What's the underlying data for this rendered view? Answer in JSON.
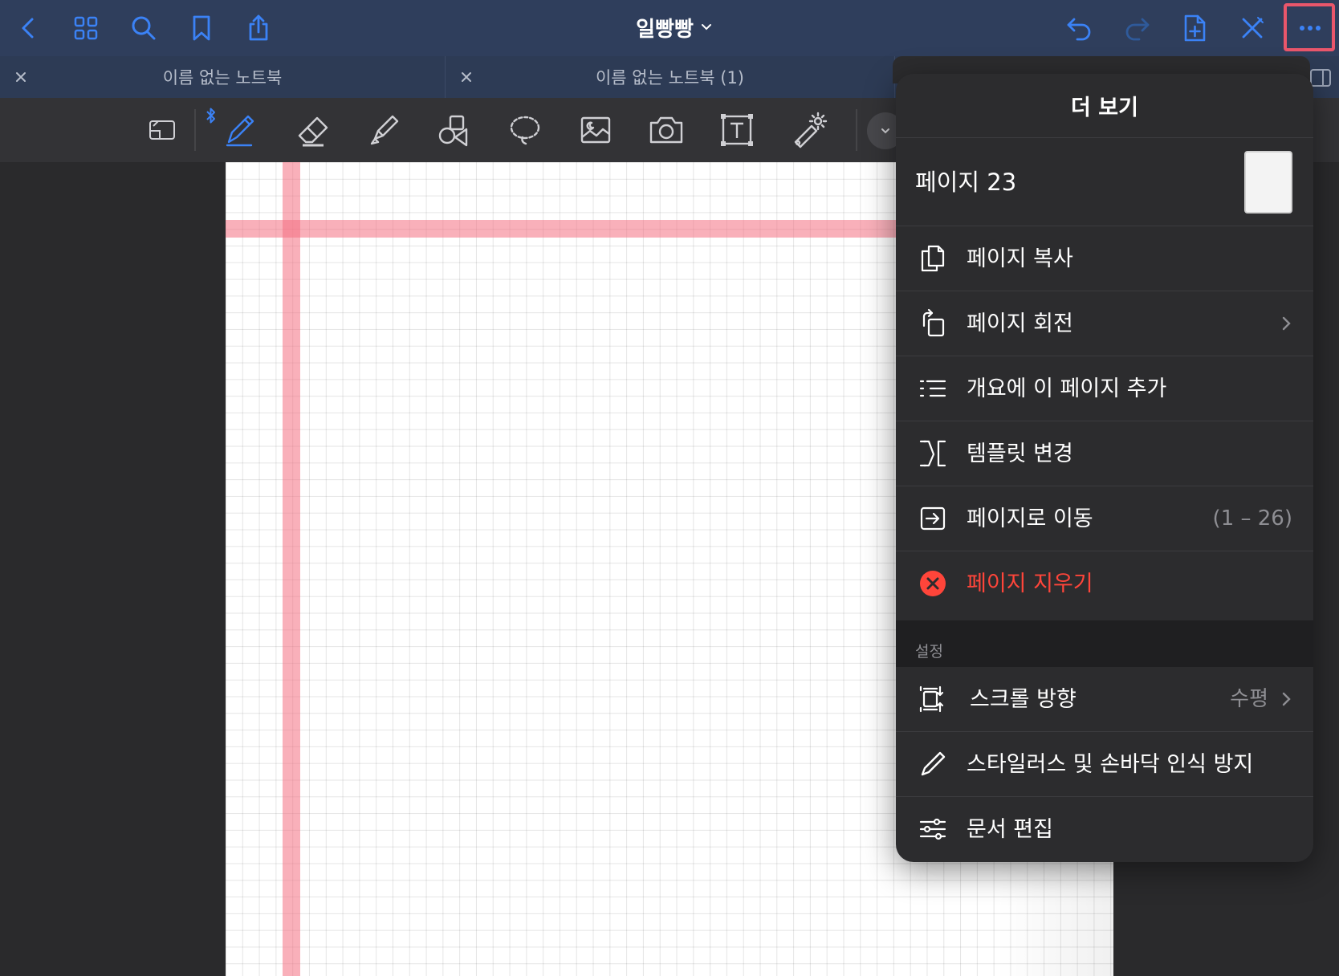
{
  "app": {
    "document_title": "일빵빵"
  },
  "topbar": {
    "left_icons": [
      "back-icon",
      "grid-icon",
      "search-icon",
      "bookmark-icon",
      "share-icon"
    ],
    "right_icons": [
      "undo-icon",
      "redo-icon",
      "add-page-icon",
      "close-toolbar-icon",
      "more-icon"
    ],
    "accent_color": "#3b82f6",
    "highlight_color": "#e9566b"
  },
  "tabs": [
    {
      "label": "이름 없는 노트북"
    },
    {
      "label": "이름 없는 노트북 (1)"
    }
  ],
  "toolbar": {
    "tools": [
      "zoom-window-icon",
      "pen-icon",
      "eraser-icon",
      "highlighter-icon",
      "shapes-icon",
      "lasso-icon",
      "image-icon",
      "camera-icon",
      "text-icon",
      "laser-pointer-icon"
    ],
    "selected_tool": "pen-icon"
  },
  "menu": {
    "title": "더 보기",
    "page_label": "페이지 23",
    "items": [
      {
        "label": "페이지 복사",
        "icon": "copy-page-icon"
      },
      {
        "label": "페이지 회전",
        "icon": "rotate-page-icon",
        "chevron": true
      },
      {
        "label": "개요에 이 페이지 추가",
        "icon": "outline-list-icon"
      },
      {
        "label": "템플릿 변경",
        "icon": "template-icon"
      },
      {
        "label": "페이지로 이동",
        "icon": "go-to-page-icon",
        "detail": "(1 – 26)"
      },
      {
        "label": "페이지 지우기",
        "icon": "delete-page-icon",
        "danger": true
      }
    ],
    "settings_header": "설정",
    "settings": [
      {
        "label": "스크롤 방향",
        "icon": "scroll-direction-icon",
        "detail": "수평",
        "chevron": true
      },
      {
        "label": "스타일러스 및 손바닥 인식 방지",
        "icon": "stylus-icon"
      },
      {
        "label": "문서 편집",
        "icon": "sliders-icon"
      }
    ],
    "danger_color": "#ff453a"
  }
}
